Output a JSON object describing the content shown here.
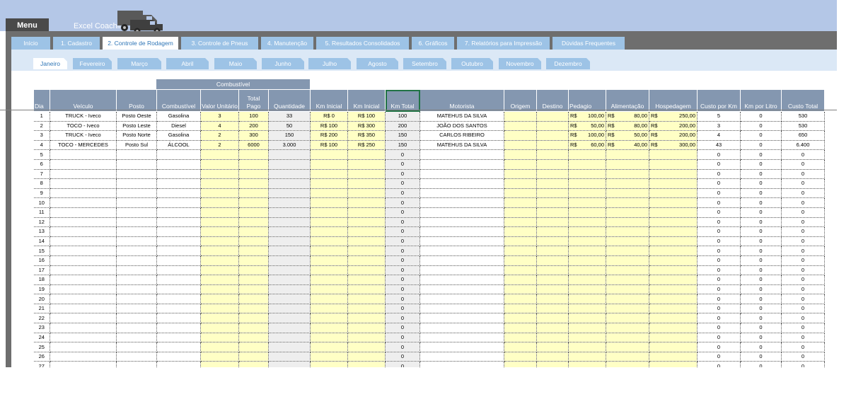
{
  "header": {
    "menu_label": "Menu",
    "brand": "Excel Coaching"
  },
  "nav_tabs": [
    {
      "label": "Início",
      "active": false
    },
    {
      "label": "1. Cadastro",
      "active": false
    },
    {
      "label": "2. Controle de Rodagem",
      "active": true
    },
    {
      "label": "3. Controle de Pneus",
      "active": false
    },
    {
      "label": "4. Manutenção",
      "active": false
    },
    {
      "label": "5. Resultados Consolidados",
      "active": false
    },
    {
      "label": "6. Gráficos",
      "active": false
    },
    {
      "label": "7.  Relatórios para Impressão",
      "active": false
    },
    {
      "label": "Dúvidas Frequentes",
      "active": false
    }
  ],
  "month_tabs": [
    {
      "label": "Janeiro",
      "active": true
    },
    {
      "label": "Fevereiro",
      "active": false
    },
    {
      "label": "Março",
      "active": false
    },
    {
      "label": "Abril",
      "active": false
    },
    {
      "label": "Maio",
      "active": false
    },
    {
      "label": "Junho",
      "active": false
    },
    {
      "label": "Julho",
      "active": false
    },
    {
      "label": "Agosto",
      "active": false
    },
    {
      "label": "Setembro",
      "active": false
    },
    {
      "label": "Outubro",
      "active": false
    },
    {
      "label": "Novembro",
      "active": false
    },
    {
      "label": "Dezembro",
      "active": false
    }
  ],
  "table": {
    "group_header": "Combustível",
    "columns": [
      "Dia",
      "Veículo",
      "Posto",
      "Combustível",
      "Valor Unitário",
      "Total Pago",
      "Quantidade",
      "Km Inicial",
      "Km Inicial",
      "Km Total",
      "Motorista",
      "Origem",
      "Destino",
      "Pedagio",
      "Alimentação",
      "Hospedagem",
      "Custo por Km",
      "Km por Litro",
      "Custo Total"
    ],
    "currency": "R$",
    "rows": [
      {
        "dia": "1",
        "veiculo": "TRUCK - Iveco",
        "posto": "Posto Oeste",
        "combustivel": "Gasolina",
        "valor": "3",
        "total": "100",
        "quantidade": "33",
        "km_ini": "R$ 0",
        "km_ini2": "R$ 100",
        "km_total": "100",
        "motorista": "MATEHUS DA SILVA",
        "origem": "",
        "destino": "",
        "pedagio": "100,00",
        "alimentacao": "80,00",
        "hospedagem": "250,00",
        "custo_km": "5",
        "km_litro": "0",
        "custo_total": "530"
      },
      {
        "dia": "2",
        "veiculo": "TOCO - Iveco",
        "posto": "Posto Leste",
        "combustivel": "Diesel",
        "valor": "4",
        "total": "200",
        "quantidade": "50",
        "km_ini": "R$ 100",
        "km_ini2": "R$ 300",
        "km_total": "200",
        "motorista": "JOÃO DOS SANTOS",
        "origem": "",
        "destino": "",
        "pedagio": "50,00",
        "alimentacao": "80,00",
        "hospedagem": "200,00",
        "custo_km": "3",
        "km_litro": "0",
        "custo_total": "530"
      },
      {
        "dia": "3",
        "veiculo": "TRUCK - Iveco",
        "posto": "Posto Norte",
        "combustivel": "Gasolina",
        "valor": "2",
        "total": "300",
        "quantidade": "150",
        "km_ini": "R$ 200",
        "km_ini2": "R$ 350",
        "km_total": "150",
        "motorista": "CARLOS RIBEIRO",
        "origem": "",
        "destino": "",
        "pedagio": "100,00",
        "alimentacao": "50,00",
        "hospedagem": "200,00",
        "custo_km": "4",
        "km_litro": "0",
        "custo_total": "650"
      },
      {
        "dia": "4",
        "veiculo": "TOCO - MERCEDES",
        "posto": "Posto Sul",
        "combustivel": "ÁLCOOL",
        "valor": "2",
        "total": "6000",
        "quantidade": "3.000",
        "km_ini": "R$ 100",
        "km_ini2": "R$ 250",
        "km_total": "150",
        "motorista": "MATEHUS DA SILVA",
        "origem": "",
        "destino": "",
        "pedagio": "60,00",
        "alimentacao": "40,00",
        "hospedagem": "300,00",
        "custo_km": "43",
        "km_litro": "0",
        "custo_total": "6.400"
      }
    ],
    "empty_rows": [
      "5",
      "6",
      "7",
      "8",
      "9",
      "10",
      "11",
      "12",
      "13",
      "14",
      "15",
      "16",
      "17",
      "18",
      "19",
      "20",
      "21",
      "22",
      "23",
      "24",
      "25",
      "26",
      "27"
    ],
    "empty_values": {
      "km_total": "0",
      "custo_km": "0",
      "km_litro": "0",
      "custo_total": "0"
    }
  },
  "colors": {
    "header_blue": "#8497b0",
    "tab_blue": "#9dc3e6",
    "input_yellow": "#ffffc5",
    "top_band": "#b4c7e7"
  }
}
